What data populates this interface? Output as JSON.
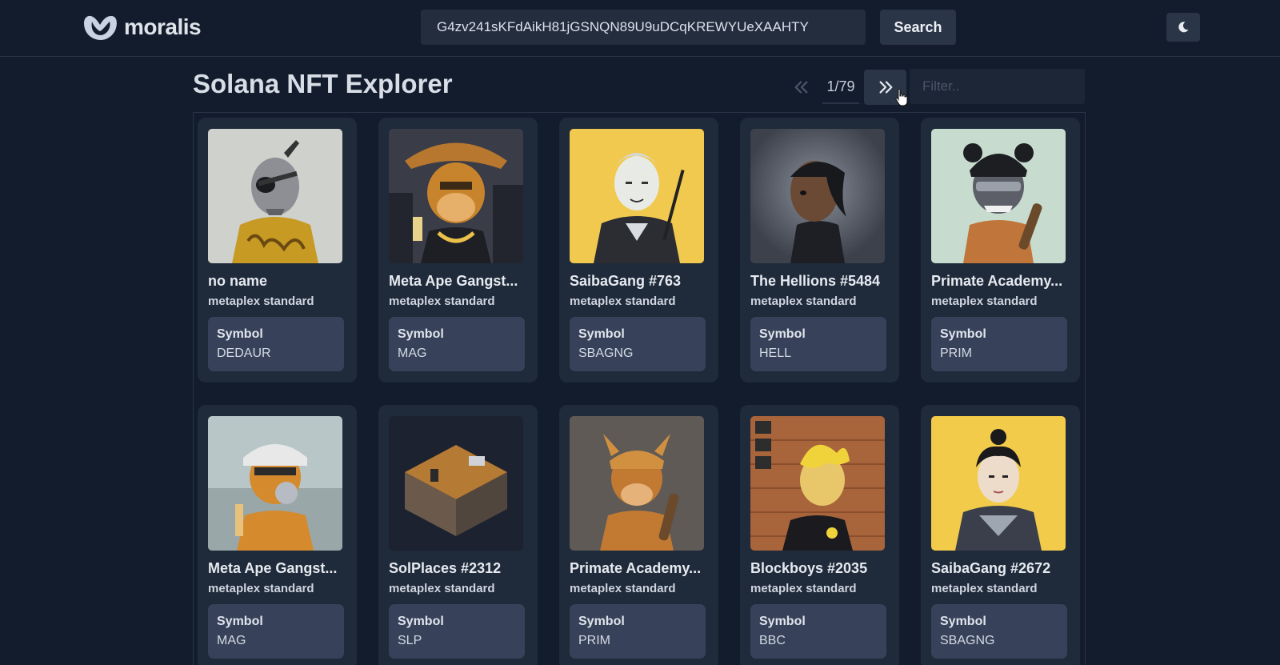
{
  "header": {
    "brand": "moralis",
    "search_value": "G4zv241sKFdAikH81jGSNQN89U9uDCqKREWYUeXAAHTY",
    "search_button": "Search",
    "theme_icon": "moon-icon"
  },
  "toolbar": {
    "title": "Solana NFT Explorer",
    "page_indicator": "1/79",
    "filter_placeholder": "Filter..",
    "prev_icon": "chevrons-left-icon",
    "next_icon": "chevrons-right-icon"
  },
  "nfts": [
    {
      "name": "no name",
      "standard": "metaplex standard",
      "symbol_label": "Symbol",
      "symbol": "DEDAUR",
      "bg": "#c9cbc6",
      "accent": "#c89a1f"
    },
    {
      "name": "Meta Ape Gangst...",
      "standard": "metaplex standard",
      "symbol_label": "Symbol",
      "symbol": "MAG",
      "bg": "#2c2f3a",
      "accent": "#c8842c"
    },
    {
      "name": "SaibaGang #763",
      "standard": "metaplex standard",
      "symbol_label": "Symbol",
      "symbol": "SBAGNG",
      "bg": "#f1c94f",
      "accent": "#2b2d33"
    },
    {
      "name": "The Hellions #5484",
      "standard": "metaplex standard",
      "symbol_label": "Symbol",
      "symbol": "HELL",
      "bg": "#4a505c",
      "accent": "#1b1d22"
    },
    {
      "name": "Primate Academy...",
      "standard": "metaplex standard",
      "symbol_label": "Symbol",
      "symbol": "PRIM",
      "bg": "#c7dccf",
      "accent": "#b86a2b"
    },
    {
      "name": "Meta Ape Gangst...",
      "standard": "metaplex standard",
      "symbol_label": "Symbol",
      "symbol": "MAG",
      "bg": "#b9c6c8",
      "accent": "#d48a2d"
    },
    {
      "name": "SolPlaces #2312",
      "standard": "metaplex standard",
      "symbol_label": "Symbol",
      "symbol": "SLP",
      "bg": "#1c2230",
      "accent": "#b57a33"
    },
    {
      "name": "Primate Academy...",
      "standard": "metaplex standard",
      "symbol_label": "Symbol",
      "symbol": "PRIM",
      "bg": "#5f5a56",
      "accent": "#c27a33"
    },
    {
      "name": "Blockboys #2035",
      "standard": "metaplex standard",
      "symbol_label": "Symbol",
      "symbol": "BBC",
      "bg": "#a8643a",
      "accent": "#f0d33a"
    },
    {
      "name": "SaibaGang #2672",
      "standard": "metaplex standard",
      "symbol_label": "Symbol",
      "symbol": "SBAGNG",
      "bg": "#f3cb4a",
      "accent": "#3a3f4b"
    }
  ]
}
